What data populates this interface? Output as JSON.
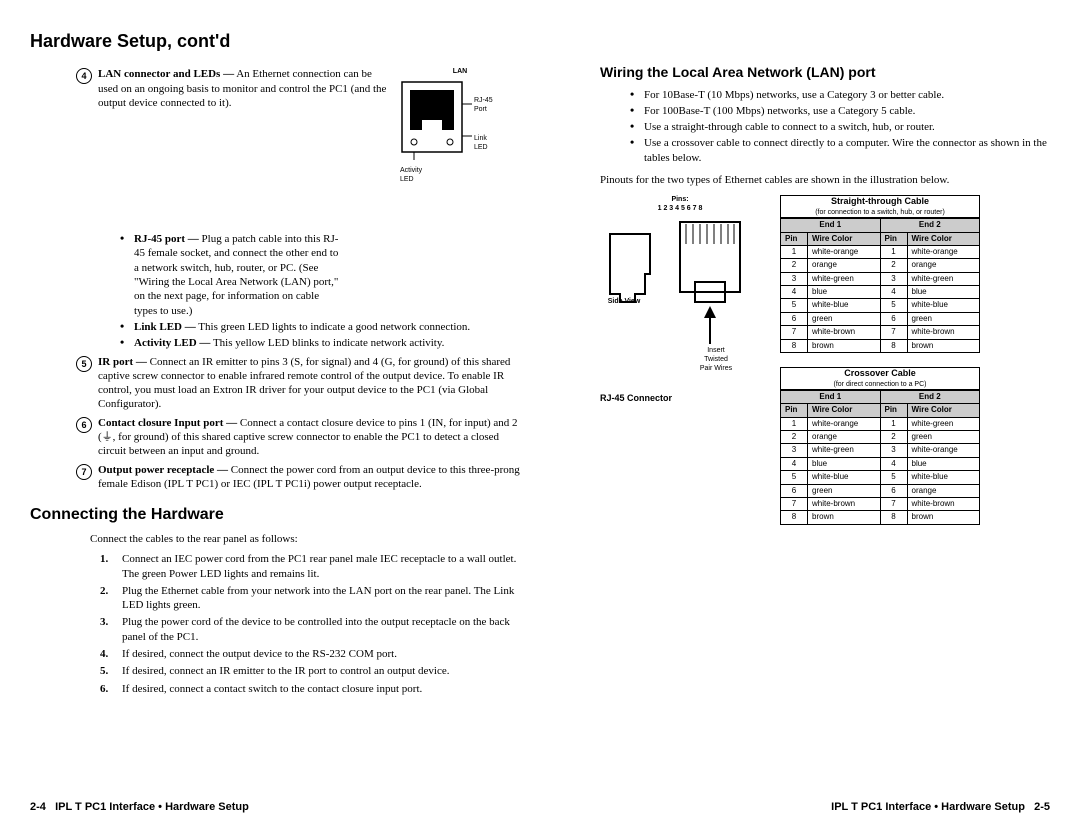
{
  "title": "Hardware Setup, cont'd",
  "item4": {
    "num": "4",
    "lead": "LAN connector and LEDs —",
    "body": " An Ethernet connection can be used on an ongoing basis to monitor and control the PC1 (and the output device connected to it).",
    "sub": [
      {
        "lead": "RJ-45 port —",
        "body": " Plug a patch cable into this RJ-45 female socket, and connect the other end to a network switch, hub, router, or PC. (See \"Wiring the Local Area Network (LAN) port,\" on the next page, for information on cable types to use.)"
      },
      {
        "lead": "Link LED —",
        "body": " This green LED lights to indicate a good network connection."
      },
      {
        "lead": "Activity LED —",
        "body": " This yellow LED blinks to indicate network activity."
      }
    ],
    "fig": {
      "lan": "LAN",
      "rj45": "RJ-45\nPort",
      "link": "Link\nLED",
      "act": "Activity\nLED"
    }
  },
  "item5": {
    "num": "5",
    "lead": "IR port —",
    "body": " Connect an IR emitter to pins 3 (S, for signal) and 4 (G, for ground) of this shared captive screw connector to enable infrared remote control of the output device. To enable IR control, you must load an Extron IR driver for your output device to the PC1 (via Global Configurator)."
  },
  "item6": {
    "num": "6",
    "lead": "Contact closure Input port —",
    "body": " Connect a contact closure device to pins 1 (IN, for input) and 2 (⏚, for ground) of this shared captive screw connector to enable the PC1 to detect a closed circuit between an input and ground."
  },
  "item7": {
    "num": "7",
    "lead": "Output power receptacle —",
    "body": " Connect the power cord from an output device to this three-prong female Edison (IPL T PC1) or IEC (IPL T PC1i) power output receptacle."
  },
  "connecting": {
    "heading": "Connecting the Hardware",
    "intro": "Connect the cables to the rear panel as follows:",
    "steps": [
      "Connect an IEC power cord from the PC1 rear panel male IEC receptacle to a wall outlet. The green Power LED lights and remains lit.",
      "Plug the Ethernet cable from your network into the LAN port on the rear panel. The Link LED lights green.",
      "Plug the power cord of the device to be controlled into the output receptacle on the back panel of the PC1.",
      "If desired, connect the output device to the RS-232 COM port.",
      "If desired, connect an IR emitter to the IR port to control an output device.",
      "If desired, connect a contact switch to the contact closure input port."
    ]
  },
  "wiring": {
    "heading": "Wiring the Local Area Network (LAN) port",
    "bullets": [
      "For 10Base-T (10 Mbps) networks, use a Category 3 or better cable.",
      "For 100Base-T (100 Mbps) networks, use a Category 5 cable.",
      "Use a straight-through cable to connect to a switch, hub, or router.",
      "Use a crossover cable to connect directly to a computer. Wire the connector as shown in the tables below."
    ],
    "intro2": "Pinouts for the two types of Ethernet cables are shown in the illustration below."
  },
  "rj45": {
    "pins": "Pins:\n1 2 3 4 5 6 7 8",
    "side": "Side View",
    "insert": "Insert\nTwisted\nPair Wires",
    "label": "RJ-45 Connector"
  },
  "tables": {
    "straight": {
      "title": "Straight-through Cable",
      "sub": "(for connection to a switch, hub, or router)",
      "end1": "End 1",
      "end2": "End 2",
      "pin": "Pin",
      "wire": "Wire Color",
      "rows": [
        [
          "1",
          "white-orange",
          "1",
          "white-orange"
        ],
        [
          "2",
          "orange",
          "2",
          "orange"
        ],
        [
          "3",
          "white-green",
          "3",
          "white-green"
        ],
        [
          "4",
          "blue",
          "4",
          "blue"
        ],
        [
          "5",
          "white-blue",
          "5",
          "white-blue"
        ],
        [
          "6",
          "green",
          "6",
          "green"
        ],
        [
          "7",
          "white-brown",
          "7",
          "white-brown"
        ],
        [
          "8",
          "brown",
          "8",
          "brown"
        ]
      ]
    },
    "cross": {
      "title": "Crossover Cable",
      "sub": "(for direct connection to a PC)",
      "end1": "End 1",
      "end2": "End 2",
      "pin": "Pin",
      "wire": "Wire Color",
      "rows": [
        [
          "1",
          "white-orange",
          "1",
          "white-green"
        ],
        [
          "2",
          "orange",
          "2",
          "green"
        ],
        [
          "3",
          "white-green",
          "3",
          "white-orange"
        ],
        [
          "4",
          "blue",
          "4",
          "blue"
        ],
        [
          "5",
          "white-blue",
          "5",
          "white-blue"
        ],
        [
          "6",
          "green",
          "6",
          "orange"
        ],
        [
          "7",
          "white-brown",
          "7",
          "white-brown"
        ],
        [
          "8",
          "brown",
          "8",
          "brown"
        ]
      ]
    }
  },
  "footer": {
    "left_page": "2-4",
    "left_text": "IPL T PC1 Interface • Hardware Setup",
    "right_text": "IPL T PC1 Interface • Hardware Setup",
    "right_page": "2-5"
  }
}
